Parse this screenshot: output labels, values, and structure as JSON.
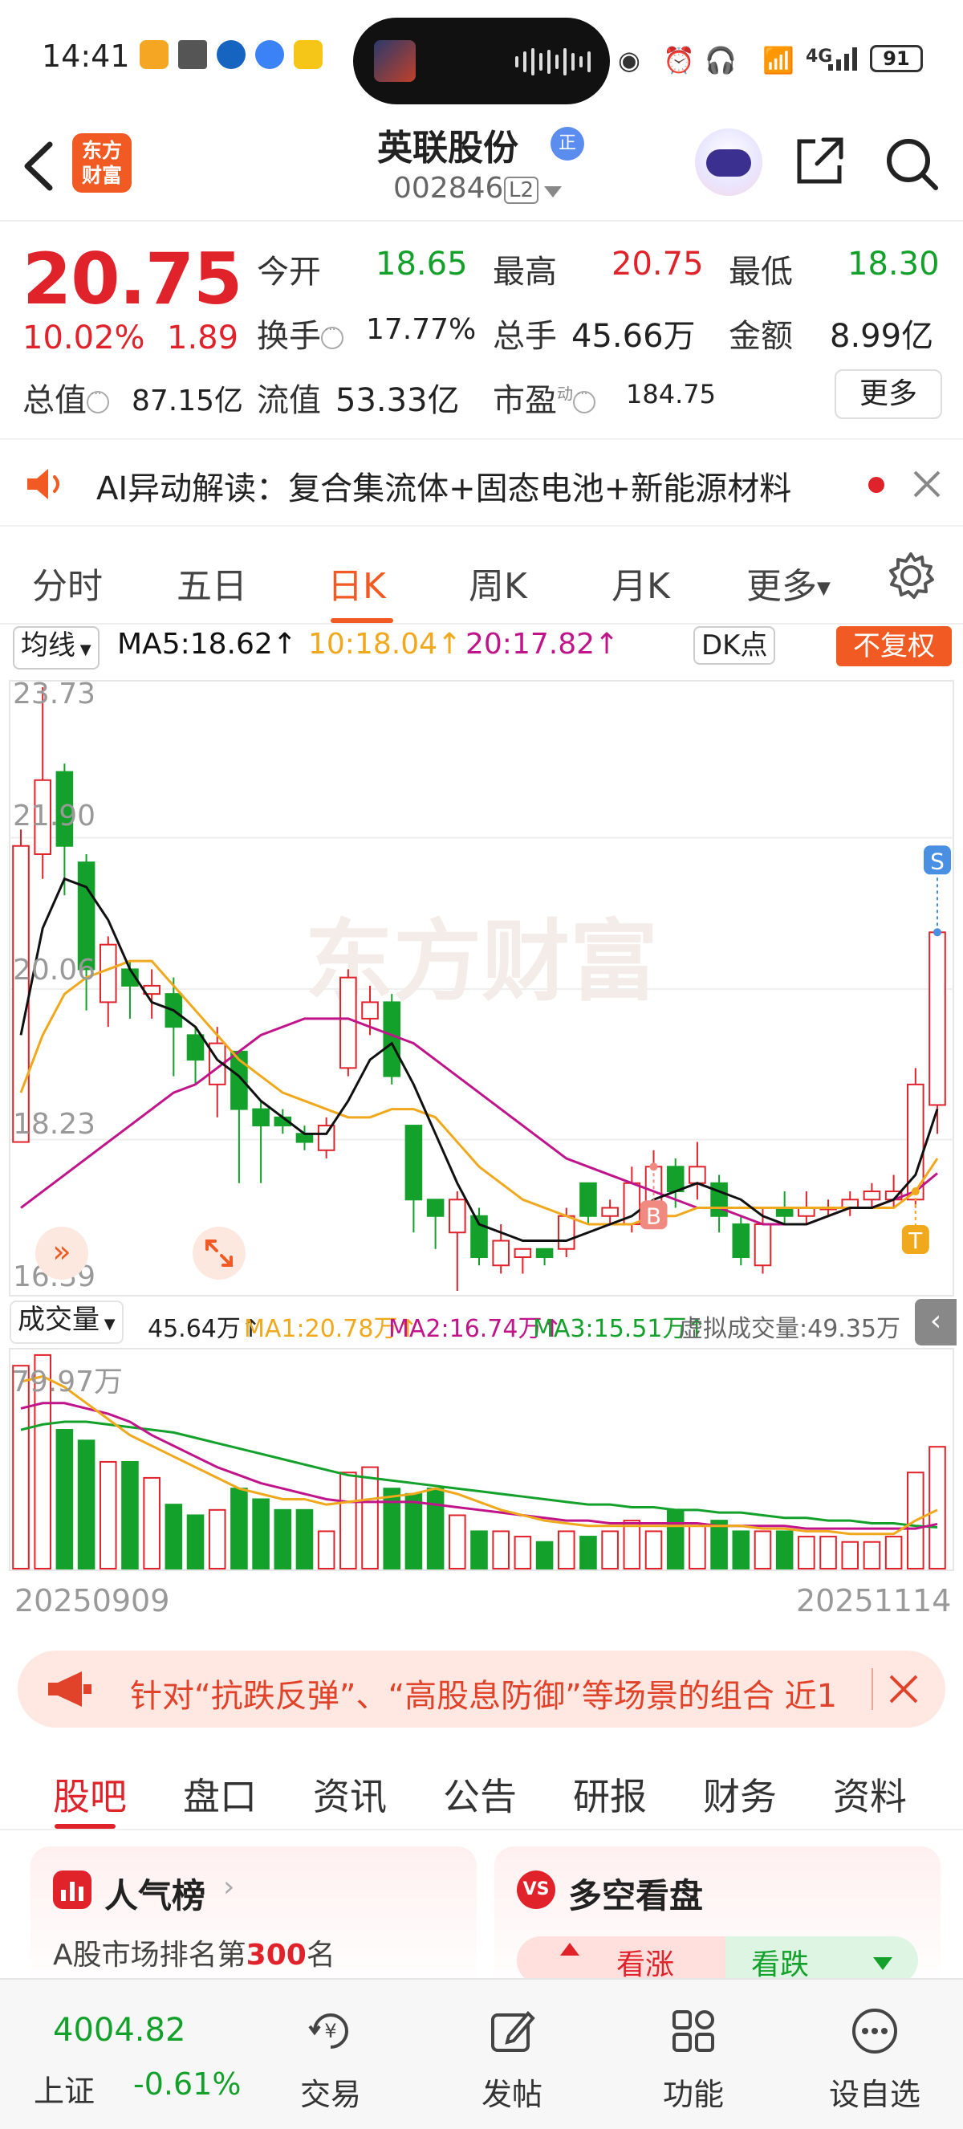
{
  "status": {
    "time": "14:41",
    "battery": "91",
    "network": "4G"
  },
  "header": {
    "stock_name": "英联股份",
    "z_badge": "正",
    "code": "002846",
    "level": "L2",
    "logo_line1": "东方",
    "logo_line2": "财富"
  },
  "quote": {
    "price": "20.75",
    "pct": "10.02%",
    "change": "1.89",
    "open_label": "今开",
    "open": "18.65",
    "high_label": "最高",
    "high": "20.75",
    "low_label": "最低",
    "low": "18.30",
    "turnover_label": "换手",
    "turnover": "17.77%",
    "volume_label": "总手",
    "volume": "45.66万",
    "amount_label": "金额",
    "amount": "8.99亿",
    "mktcap_label": "总值",
    "mktcap": "87.15亿",
    "float_label": "流值",
    "float_cap": "53.33亿",
    "pe_label": "市盈",
    "pe_sup": "动",
    "pe": "184.75",
    "more": "更多"
  },
  "ai_bar": {
    "text": "AI异动解读：复合集流体+固态电池+新能源材料"
  },
  "tabs": {
    "fenshi": "分时",
    "wuri": "五日",
    "rik": "日K",
    "zhouk": "周K",
    "yuek": "月K",
    "more": "更多"
  },
  "ma_bar": {
    "selector": "均线",
    "ma5": "MA5:18.62↑",
    "ma10": "10:18.04↑",
    "ma20": "20:17.82↑",
    "dk": "DK点",
    "fuquan": "不复权"
  },
  "colors": {
    "up": "#e0222b",
    "down": "#14a12b",
    "ma5": "#111111",
    "ma10": "#f0a81c",
    "ma20": "#c0148a",
    "accent": "#f15a22"
  },
  "kline_axis": {
    "y_labels": [
      "23.73",
      "21.90",
      "20.06",
      "18.23",
      "16.39"
    ]
  },
  "markers": {
    "b": "B",
    "s": "S",
    "t": "T"
  },
  "watermark": "东方财富",
  "vol_bar": {
    "selector": "成交量",
    "vol": "45.64万↑",
    "ma1": "MA1:20.78万↑",
    "ma2": "MA2:16.74万↑",
    "ma3": "MA3:15.51万↑",
    "virtual": "虚拟成交量:49.35万"
  },
  "vol_axis": {
    "top_label": "79.97万"
  },
  "date_axis": {
    "start": "20250909",
    "end": "20251114"
  },
  "banner": {
    "text": "针对“抗跌反弹”、“高股息防御”等场景的组合 近1"
  },
  "bottom_tabs": [
    "股吧",
    "盘口",
    "资讯",
    "公告",
    "研报",
    "财务",
    "资料"
  ],
  "cards": {
    "popularity_title": "人气榜",
    "popularity_sub_prefix": "A股市场排名第",
    "popularity_rank": "300",
    "popularity_sub_suffix": "名",
    "vs_badge": "VS",
    "duokong_title": "多空看盘",
    "bull": "看涨",
    "bear": "看跌"
  },
  "bottom_nav": {
    "index_value": "4004.82",
    "index_name": "上证",
    "index_change": "-0.61%",
    "trade": "交易",
    "post": "发帖",
    "func": "功能",
    "watch": "设自选"
  },
  "chart_data": {
    "type": "candlestick",
    "candles": [
      {
        "o": 18.2,
        "c": 21.8,
        "h": 22.0,
        "l": 18.2
      },
      {
        "o": 21.7,
        "c": 22.6,
        "h": 23.73,
        "l": 21.4
      },
      {
        "o": 22.7,
        "c": 21.8,
        "h": 22.8,
        "l": 21.2
      },
      {
        "o": 21.6,
        "c": 20.3,
        "h": 21.7,
        "l": 19.8
      },
      {
        "o": 19.9,
        "c": 20.6,
        "h": 20.7,
        "l": 19.6
      },
      {
        "o": 20.3,
        "c": 20.1,
        "h": 20.4,
        "l": 19.7
      },
      {
        "o": 20.0,
        "c": 20.1,
        "h": 20.3,
        "l": 19.7
      },
      {
        "o": 20.0,
        "c": 19.6,
        "h": 20.2,
        "l": 19.0
      },
      {
        "o": 19.5,
        "c": 19.2,
        "h": 19.6,
        "l": 18.9
      },
      {
        "o": 18.9,
        "c": 19.4,
        "h": 19.6,
        "l": 18.5
      },
      {
        "o": 19.3,
        "c": 18.6,
        "h": 19.3,
        "l": 17.7
      },
      {
        "o": 18.6,
        "c": 18.4,
        "h": 18.7,
        "l": 17.7
      },
      {
        "o": 18.5,
        "c": 18.4,
        "h": 18.6,
        "l": 18.3
      },
      {
        "o": 18.3,
        "c": 18.2,
        "h": 18.4,
        "l": 18.1
      },
      {
        "o": 18.1,
        "c": 18.4,
        "h": 18.5,
        "l": 18.0
      },
      {
        "o": 19.1,
        "c": 20.2,
        "h": 20.3,
        "l": 19.0
      },
      {
        "o": 19.7,
        "c": 19.9,
        "h": 20.1,
        "l": 19.5
      },
      {
        "o": 19.9,
        "c": 19.0,
        "h": 20.0,
        "l": 18.9
      },
      {
        "o": 18.4,
        "c": 17.5,
        "h": 18.4,
        "l": 17.1
      },
      {
        "o": 17.5,
        "c": 17.3,
        "h": 17.5,
        "l": 16.9
      },
      {
        "o": 17.1,
        "c": 17.5,
        "h": 17.6,
        "l": 16.39
      },
      {
        "o": 17.3,
        "c": 16.8,
        "h": 17.4,
        "l": 16.7
      },
      {
        "o": 16.7,
        "c": 17.0,
        "h": 17.2,
        "l": 16.6
      },
      {
        "o": 16.8,
        "c": 16.9,
        "h": 16.9,
        "l": 16.6
      },
      {
        "o": 16.9,
        "c": 16.8,
        "h": 16.9,
        "l": 16.7
      },
      {
        "o": 16.9,
        "c": 17.3,
        "h": 17.4,
        "l": 16.8
      },
      {
        "o": 17.7,
        "c": 17.3,
        "h": 17.7,
        "l": 17.2
      },
      {
        "o": 17.3,
        "c": 17.4,
        "h": 17.5,
        "l": 17.2
      },
      {
        "o": 17.2,
        "c": 17.7,
        "h": 17.9,
        "l": 17.1
      },
      {
        "o": 17.4,
        "c": 17.9,
        "h": 18.1,
        "l": 17.2
      },
      {
        "o": 17.9,
        "c": 17.6,
        "h": 18.0,
        "l": 17.4
      },
      {
        "o": 17.7,
        "c": 17.9,
        "h": 18.2,
        "l": 17.5
      },
      {
        "o": 17.7,
        "c": 17.3,
        "h": 17.8,
        "l": 17.1
      },
      {
        "o": 17.2,
        "c": 16.8,
        "h": 17.3,
        "l": 16.7
      },
      {
        "o": 16.7,
        "c": 17.2,
        "h": 17.4,
        "l": 16.6
      },
      {
        "o": 17.4,
        "c": 17.3,
        "h": 17.6,
        "l": 17.2
      },
      {
        "o": 17.3,
        "c": 17.4,
        "h": 17.6,
        "l": 17.2
      },
      {
        "o": 17.4,
        "c": 17.4,
        "h": 17.5,
        "l": 17.3
      },
      {
        "o": 17.4,
        "c": 17.5,
        "h": 17.6,
        "l": 17.3
      },
      {
        "o": 17.5,
        "c": 17.6,
        "h": 17.7,
        "l": 17.4
      },
      {
        "o": 17.5,
        "c": 17.6,
        "h": 17.8,
        "l": 17.4
      },
      {
        "o": 17.5,
        "c": 18.9,
        "h": 19.1,
        "l": 17.4
      },
      {
        "o": 18.65,
        "c": 20.75,
        "h": 20.75,
        "l": 18.3
      }
    ],
    "ma5": [
      19.5,
      20.8,
      21.4,
      21.3,
      20.9,
      20.3,
      19.9,
      19.8,
      19.6,
      19.2,
      19.0,
      18.7,
      18.5,
      18.3,
      18.3,
      18.7,
      19.2,
      19.4,
      18.9,
      18.3,
      17.7,
      17.2,
      17.1,
      17.0,
      17.0,
      17.0,
      17.1,
      17.2,
      17.3,
      17.5,
      17.6,
      17.7,
      17.6,
      17.5,
      17.3,
      17.2,
      17.2,
      17.3,
      17.4,
      17.4,
      17.5,
      17.8,
      18.6
    ],
    "ma10": [
      18.8,
      19.5,
      20.0,
      20.2,
      20.3,
      20.4,
      20.4,
      20.1,
      19.8,
      19.5,
      19.2,
      19.0,
      18.8,
      18.7,
      18.6,
      18.5,
      18.5,
      18.6,
      18.6,
      18.5,
      18.2,
      17.9,
      17.7,
      17.5,
      17.4,
      17.3,
      17.2,
      17.2,
      17.2,
      17.3,
      17.3,
      17.4,
      17.4,
      17.4,
      17.4,
      17.4,
      17.4,
      17.4,
      17.4,
      17.4,
      17.4,
      17.6,
      18.0
    ],
    "ma20": [
      17.4,
      17.6,
      17.8,
      18.0,
      18.2,
      18.4,
      18.6,
      18.8,
      18.9,
      19.1,
      19.3,
      19.5,
      19.6,
      19.7,
      19.7,
      19.7,
      19.6,
      19.5,
      19.4,
      19.2,
      19.0,
      18.8,
      18.6,
      18.4,
      18.2,
      18.0,
      17.9,
      17.8,
      17.7,
      17.6,
      17.5,
      17.4,
      17.4,
      17.3,
      17.2,
      17.2,
      17.2,
      17.3,
      17.4,
      17.4,
      17.5,
      17.6,
      17.82
    ],
    "volume_wan": [
      76,
      80,
      52,
      48,
      40,
      40,
      34,
      24,
      20,
      22,
      30,
      26,
      22,
      22,
      14,
      36,
      38,
      30,
      28,
      30,
      20,
      14,
      14,
      12,
      10,
      14,
      12,
      14,
      18,
      14,
      22,
      16,
      18,
      14,
      14,
      14,
      12,
      12,
      10,
      10,
      12,
      36,
      45.64
    ],
    "vol_ma1": [
      70,
      72,
      68,
      62,
      56,
      50,
      46,
      42,
      38,
      34,
      30,
      28,
      26,
      26,
      24,
      25,
      26,
      27,
      28,
      30,
      28,
      25,
      22,
      20,
      18,
      17,
      16,
      16,
      16,
      16,
      16,
      16,
      16,
      16,
      15,
      15,
      14,
      14,
      13,
      13,
      13,
      18,
      22
    ],
    "vol_ma2": [
      60,
      62,
      62,
      60,
      58,
      55,
      50,
      46,
      42,
      38,
      35,
      32,
      30,
      28,
      26,
      25,
      25,
      25,
      25,
      24,
      23,
      22,
      21,
      20,
      19,
      18,
      18,
      17,
      17,
      17,
      17,
      17,
      16,
      16,
      16,
      16,
      15,
      15,
      15,
      15,
      15,
      15,
      16.7
    ],
    "vol_ma3": [
      52,
      54,
      55,
      55,
      54,
      53,
      52,
      51,
      49,
      47,
      45,
      43,
      41,
      39,
      37,
      35,
      34,
      33,
      32,
      31,
      30,
      29,
      28,
      27,
      26,
      25,
      24,
      24,
      23,
      23,
      22,
      22,
      21,
      21,
      20,
      19,
      19,
      18,
      18,
      17,
      17,
      16,
      15.5
    ],
    "ylim": [
      16.39,
      23.73
    ],
    "vol_ylim": [
      0,
      79.97
    ],
    "x_range": [
      "20250909",
      "20251114"
    ]
  }
}
